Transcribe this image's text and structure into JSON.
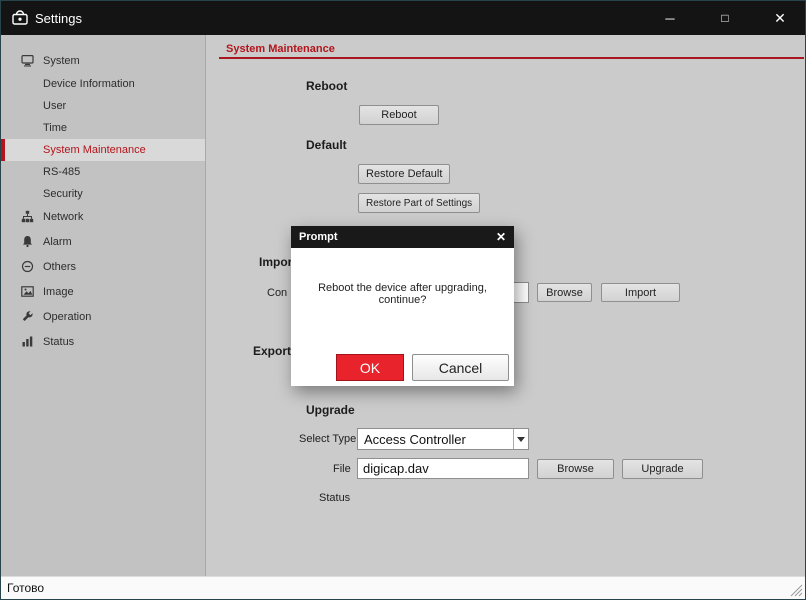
{
  "window": {
    "title": "Settings",
    "controls": {
      "minimize": "─",
      "maximize": "□",
      "close": "✕"
    }
  },
  "sidebar": {
    "items": [
      {
        "label": "System",
        "icon": "system-icon",
        "selected": false
      },
      {
        "label": "Device Information",
        "icon": "",
        "selected": false
      },
      {
        "label": "User",
        "icon": "",
        "selected": false
      },
      {
        "label": "Time",
        "icon": "",
        "selected": false
      },
      {
        "label": "System Maintenance",
        "icon": "",
        "selected": true
      },
      {
        "label": "RS-485",
        "icon": "",
        "selected": false
      },
      {
        "label": "Security",
        "icon": "",
        "selected": false
      },
      {
        "label": "Network",
        "icon": "network-icon",
        "selected": false
      },
      {
        "label": "Alarm",
        "icon": "alarm-icon",
        "selected": false
      },
      {
        "label": "Others",
        "icon": "others-icon",
        "selected": false
      },
      {
        "label": "Image",
        "icon": "image-icon",
        "selected": false
      },
      {
        "label": "Operation",
        "icon": "operation-icon",
        "selected": false
      },
      {
        "label": "Status",
        "icon": "status-icon",
        "selected": false
      }
    ]
  },
  "main": {
    "tab": "System Maintenance",
    "reboot": {
      "heading": "Reboot",
      "button": "Reboot"
    },
    "default": {
      "heading": "Default",
      "restore_default": "Restore Default",
      "restore_part": "Restore Part of Settings"
    },
    "import": {
      "heading": "Import",
      "config_label_visible": "Con",
      "browse": "Browse",
      "import": "Import"
    },
    "export": {
      "heading": "Export"
    },
    "upgrade": {
      "heading": "Upgrade",
      "select_type_label": "Select Type",
      "select_type_value": "Access Controller",
      "file_label": "File",
      "file_value": "digicap.dav",
      "browse": "Browse",
      "upgrade": "Upgrade",
      "status_label": "Status"
    }
  },
  "dialog": {
    "title": "Prompt",
    "close": "✕",
    "message": "Reboot the device after upgrading, continue?",
    "ok": "OK",
    "cancel": "Cancel"
  },
  "statusbar": {
    "text": "Готово"
  },
  "colors": {
    "titlebar": "#141414",
    "accent_red": "#b3151c",
    "ok_button_red": "#e8232b",
    "sidebar_bg": "#c2c2c2",
    "content_bg": "#cbcbcb"
  }
}
